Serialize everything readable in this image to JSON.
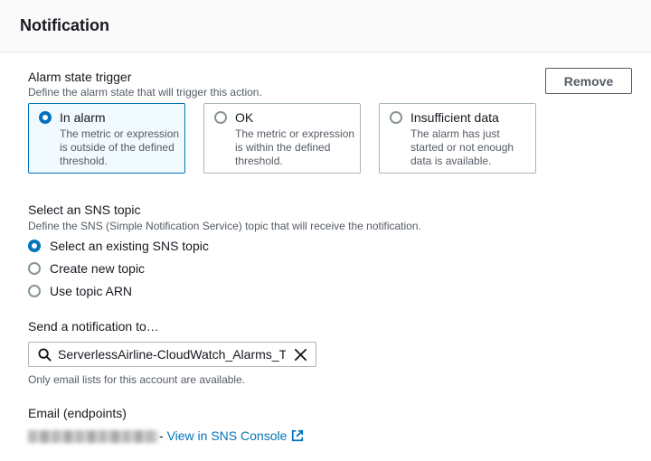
{
  "header": {
    "title": "Notification"
  },
  "alarm_state": {
    "label": "Alarm state trigger",
    "description": "Define the alarm state that will trigger this action.",
    "remove_label": "Remove",
    "options": [
      {
        "title": "In alarm",
        "description": "The metric or expression is outside of the defined threshold.",
        "selected": true
      },
      {
        "title": "OK",
        "description": "The metric or expression is within the defined threshold.",
        "selected": false
      },
      {
        "title": "Insufficient data",
        "description": "The alarm has just started or not enough data is available.",
        "selected": false
      }
    ]
  },
  "sns_topic": {
    "label": "Select an SNS topic",
    "description": "Define the SNS (Simple Notification Service) topic that will receive the notification.",
    "options": [
      {
        "label": "Select an existing SNS topic",
        "selected": true
      },
      {
        "label": "Create new topic",
        "selected": false
      },
      {
        "label": "Use topic ARN",
        "selected": false
      }
    ]
  },
  "send_to": {
    "label": "Send a notification to…",
    "value": "ServerlessAirline-CloudWatch_Alarms_Topic",
    "hint": "Only email lists for this account are available."
  },
  "email": {
    "label": "Email (endpoints)",
    "separator": "-",
    "link_label": "View in SNS Console"
  },
  "colors": {
    "accent": "#0073bb",
    "text": "#16191f",
    "muted": "#545b64",
    "border": "#aab7b8",
    "selected_bg": "#f1faff"
  }
}
